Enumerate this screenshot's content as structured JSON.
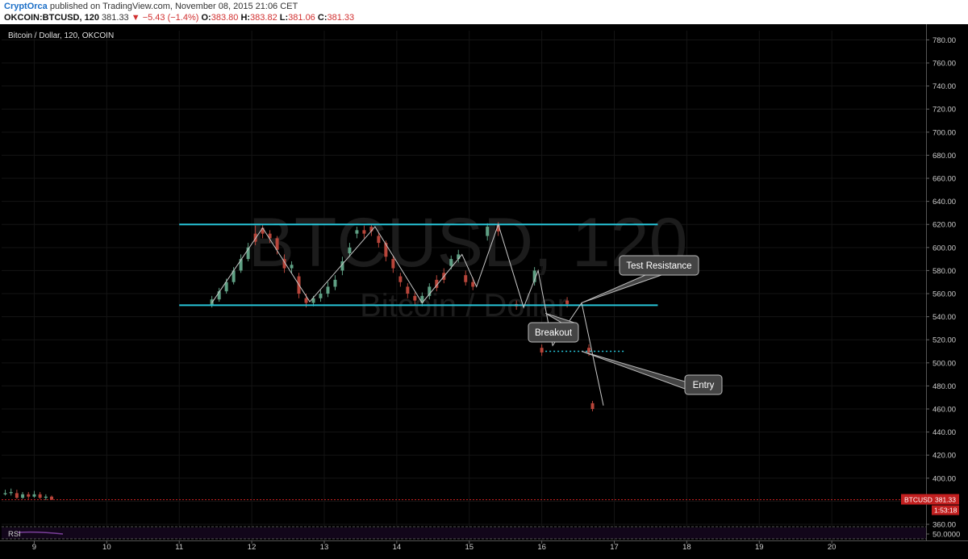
{
  "header": {
    "author": "CryptOrca",
    "published_text": "published on TradingView.com, November 08, 2015 21:06 CET",
    "symbol": "OKCOIN:BTCUSD, 120",
    "last": "381.33",
    "change_arrow": "▼",
    "change": "−5.43 (−1.4%)",
    "o_label": "O:",
    "o_value": "383.80",
    "h_label": "H:",
    "h_value": "383.82",
    "l_label": "L:",
    "l_value": "381.06",
    "c_label": "C:",
    "c_value": "381.33"
  },
  "colors": {
    "background": "#000000",
    "up_candle": "#5fa084",
    "down_candle": "#b8453a",
    "channel": "#27c4d7",
    "zigzag": "#c8c8c8",
    "price_badge": "#c21f1f",
    "rsi": "#7b3f9b"
  },
  "chart_data": {
    "type": "candlestick",
    "title": "Bitcoin / Dollar, 120, OKCOIN",
    "watermark_symbol": "BTCUSD, 120",
    "watermark_name": "Bitcoin / Dollar",
    "x_ticks": [
      "9",
      "10",
      "11",
      "12",
      "13",
      "14",
      "15",
      "16",
      "17",
      "18",
      "19",
      "20"
    ],
    "y_ticks": [
      "780.00",
      "760.00",
      "740.00",
      "720.00",
      "700.00",
      "680.00",
      "660.00",
      "640.00",
      "620.00",
      "600.00",
      "580.00",
      "560.00",
      "540.00",
      "520.00",
      "500.00",
      "480.00",
      "460.00",
      "440.00",
      "420.00",
      "400.00",
      "380.00",
      "360.00"
    ],
    "ylim": [
      360,
      788
    ],
    "xlim": [
      8.55,
      21.3
    ],
    "last_price_label": "BTCUSD",
    "last_price_value": "381.33",
    "last_price": 381.33,
    "countdown": "1:53:18",
    "channel": {
      "upper": 620,
      "lower": 550,
      "x_start": 11.0,
      "x_end": 17.6
    },
    "zigzag": [
      [
        11.45,
        552
      ],
      [
        12.15,
        617
      ],
      [
        12.8,
        553
      ],
      [
        13.7,
        618
      ],
      [
        14.35,
        552
      ],
      [
        14.9,
        594
      ],
      [
        15.1,
        566
      ],
      [
        15.4,
        620
      ],
      [
        15.75,
        548
      ],
      [
        15.95,
        580
      ],
      [
        16.15,
        515
      ],
      [
        16.55,
        552
      ],
      [
        16.85,
        463
      ]
    ],
    "entry_line": {
      "y": 510,
      "x_start": 16.05,
      "x_end": 17.15
    },
    "annotations": [
      {
        "text": "Test Resistance",
        "x": 16.55,
        "y": 552
      },
      {
        "text": "Breakout",
        "x": 16.05,
        "y": 543
      },
      {
        "text": "Entry",
        "x": 16.55,
        "y": 510
      }
    ],
    "candles": [
      {
        "x": 8.6,
        "o": 386,
        "c": 387,
        "h": 390,
        "l": 385
      },
      {
        "x": 8.68,
        "o": 387,
        "c": 388,
        "h": 391,
        "l": 385
      },
      {
        "x": 8.76,
        "o": 387,
        "c": 383,
        "h": 390,
        "l": 382
      },
      {
        "x": 8.84,
        "o": 383,
        "c": 386,
        "h": 388,
        "l": 382
      },
      {
        "x": 8.92,
        "o": 386,
        "c": 384,
        "h": 388,
        "l": 382
      },
      {
        "x": 9.0,
        "o": 384,
        "c": 386,
        "h": 389,
        "l": 383
      },
      {
        "x": 9.08,
        "o": 386,
        "c": 383,
        "h": 388,
        "l": 382
      },
      {
        "x": 9.16,
        "o": 383,
        "c": 384,
        "h": 386,
        "l": 381
      },
      {
        "x": 9.24,
        "o": 384,
        "c": 381.33,
        "h": 385,
        "l": 381
      },
      {
        "x": 11.45,
        "o": 550,
        "c": 555,
        "h": 558,
        "l": 548
      },
      {
        "x": 11.55,
        "o": 555,
        "c": 562,
        "h": 565,
        "l": 553
      },
      {
        "x": 11.65,
        "o": 562,
        "c": 570,
        "h": 573,
        "l": 560
      },
      {
        "x": 11.75,
        "o": 570,
        "c": 580,
        "h": 583,
        "l": 568
      },
      {
        "x": 11.85,
        "o": 580,
        "c": 590,
        "h": 594,
        "l": 578
      },
      {
        "x": 11.95,
        "o": 590,
        "c": 600,
        "h": 604,
        "l": 588
      },
      {
        "x": 12.05,
        "o": 612,
        "c": 605,
        "h": 619,
        "l": 602
      },
      {
        "x": 12.15,
        "o": 617,
        "c": 612,
        "h": 620,
        "l": 608
      },
      {
        "x": 12.25,
        "o": 612,
        "c": 608,
        "h": 615,
        "l": 604
      },
      {
        "x": 12.35,
        "o": 608,
        "c": 598,
        "h": 610,
        "l": 594
      },
      {
        "x": 12.45,
        "o": 590,
        "c": 582,
        "h": 594,
        "l": 578
      },
      {
        "x": 12.55,
        "o": 582,
        "c": 585,
        "h": 588,
        "l": 578
      },
      {
        "x": 12.65,
        "o": 575,
        "c": 560,
        "h": 578,
        "l": 556
      },
      {
        "x": 12.75,
        "o": 556,
        "c": 552,
        "h": 560,
        "l": 548
      },
      {
        "x": 12.85,
        "o": 552,
        "c": 556,
        "h": 558,
        "l": 549
      },
      {
        "x": 12.95,
        "o": 556,
        "c": 560,
        "h": 563,
        "l": 553
      },
      {
        "x": 13.05,
        "o": 560,
        "c": 566,
        "h": 570,
        "l": 557
      },
      {
        "x": 13.15,
        "o": 566,
        "c": 572,
        "h": 576,
        "l": 563
      },
      {
        "x": 13.25,
        "o": 580,
        "c": 588,
        "h": 592,
        "l": 576
      },
      {
        "x": 13.35,
        "o": 595,
        "c": 600,
        "h": 604,
        "l": 592
      },
      {
        "x": 13.45,
        "o": 612,
        "c": 615,
        "h": 618,
        "l": 608
      },
      {
        "x": 13.55,
        "o": 615,
        "c": 612,
        "h": 619,
        "l": 608
      },
      {
        "x": 13.65,
        "o": 618,
        "c": 614,
        "h": 620,
        "l": 610
      },
      {
        "x": 13.75,
        "o": 610,
        "c": 604,
        "h": 613,
        "l": 600
      },
      {
        "x": 13.85,
        "o": 604,
        "c": 592,
        "h": 606,
        "l": 588
      },
      {
        "x": 13.95,
        "o": 590,
        "c": 582,
        "h": 593,
        "l": 578
      },
      {
        "x": 14.05,
        "o": 575,
        "c": 570,
        "h": 578,
        "l": 566
      },
      {
        "x": 14.15,
        "o": 566,
        "c": 560,
        "h": 569,
        "l": 556
      },
      {
        "x": 14.25,
        "o": 558,
        "c": 554,
        "h": 561,
        "l": 550
      },
      {
        "x": 14.35,
        "o": 552,
        "c": 558,
        "h": 561,
        "l": 549
      },
      {
        "x": 14.45,
        "o": 558,
        "c": 566,
        "h": 569,
        "l": 555
      },
      {
        "x": 14.55,
        "o": 572,
        "c": 565,
        "h": 576,
        "l": 562
      },
      {
        "x": 14.65,
        "o": 578,
        "c": 572,
        "h": 582,
        "l": 569
      },
      {
        "x": 14.75,
        "o": 584,
        "c": 590,
        "h": 593,
        "l": 581
      },
      {
        "x": 14.85,
        "o": 590,
        "c": 594,
        "h": 598,
        "l": 587
      },
      {
        "x": 14.95,
        "o": 576,
        "c": 570,
        "h": 580,
        "l": 567
      },
      {
        "x": 15.05,
        "o": 570,
        "c": 566,
        "h": 574,
        "l": 563
      },
      {
        "x": 15.25,
        "o": 610,
        "c": 618,
        "h": 621,
        "l": 606
      },
      {
        "x": 15.4,
        "o": 620,
        "c": 614,
        "h": 622,
        "l": 610
      },
      {
        "x": 15.65,
        "o": 551,
        "c": 549,
        "h": 554,
        "l": 546
      },
      {
        "x": 15.9,
        "o": 570,
        "c": 580,
        "h": 583,
        "l": 567
      },
      {
        "x": 16.0,
        "o": 513,
        "c": 509,
        "h": 516,
        "l": 506
      },
      {
        "x": 16.25,
        "o": 527,
        "c": 530,
        "h": 533,
        "l": 524
      },
      {
        "x": 16.35,
        "o": 554,
        "c": 551,
        "h": 557,
        "l": 548
      },
      {
        "x": 16.65,
        "o": 513,
        "c": 509,
        "h": 516,
        "l": 506
      },
      {
        "x": 16.7,
        "o": 465,
        "c": 460,
        "h": 467,
        "l": 458
      }
    ],
    "rsi_label": "RSI",
    "rsi_ticks": [
      "50.0000"
    ],
    "rsi_ylim": [
      0,
      100
    ],
    "rsi_value": 50
  }
}
